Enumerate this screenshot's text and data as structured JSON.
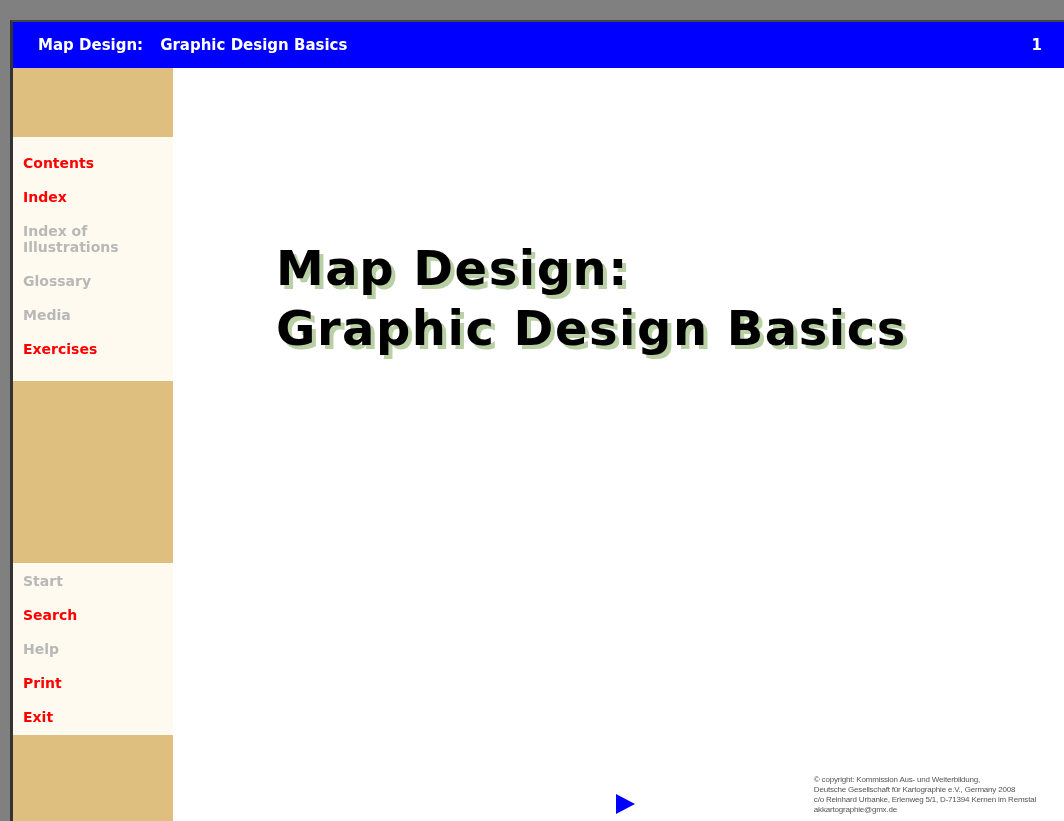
{
  "header": {
    "title": "Map Design:",
    "subtitle": "Graphic Design Basics",
    "page_number": "1"
  },
  "sidebar": {
    "groups": [
      [
        {
          "label": "Contents",
          "disabled": false
        },
        {
          "label": "Index",
          "disabled": false
        },
        {
          "label": "Index of Illustrations",
          "disabled": true
        },
        {
          "label": "Glossary",
          "disabled": true
        },
        {
          "label": "Media",
          "disabled": true
        },
        {
          "label": "Exercises",
          "disabled": false
        }
      ],
      [
        {
          "label": "Start",
          "disabled": true
        },
        {
          "label": "Search",
          "disabled": false
        },
        {
          "label": "Help",
          "disabled": true
        },
        {
          "label": "Print",
          "disabled": false
        },
        {
          "label": "Exit",
          "disabled": false
        }
      ]
    ]
  },
  "main": {
    "title_lines": [
      "Map Design:",
      "Graphic Design Basics"
    ],
    "copyright_lines": [
      "© copyright: Kommission Aus- und Weiterbildung,",
      "Deutsche Gesellschaft für Kartographie e.V., Germany 2008",
      "c/o Reinhard Urbanke, Erlenweg 5/1, D-71394 Kernen im Remstal",
      "akkartographie@gmx.de"
    ]
  }
}
